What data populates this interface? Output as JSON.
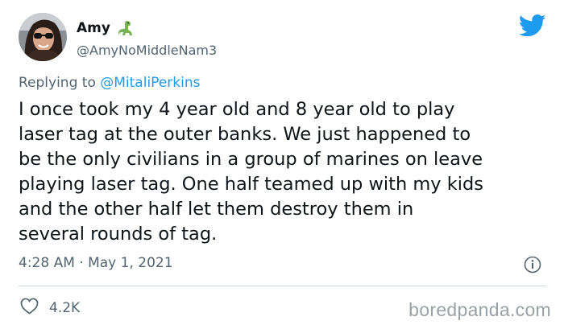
{
  "author": {
    "display_name": "Amy",
    "handle": "@AmyNoMiddleNam3",
    "emoji": "dinosaur-emoji"
  },
  "reply": {
    "prefix": "Replying to",
    "mention": "@MitaliPerkins"
  },
  "tweet": {
    "text": "I once took my 4 year old and 8 year old to play\nlaser tag at the outer banks. We just happened to\nbe the only civilians in a group of marines on leave\nplaying laser tag. One half teamed up with my kids\nand the other half let them destroy them in\nseveral rounds of tag."
  },
  "meta": {
    "timestamp": "4:28 AM · May 1, 2021"
  },
  "actions": {
    "likes": "4.2K"
  },
  "watermark": "boredpanda.com",
  "colors": {
    "twitter_blue": "#1d9bf0",
    "secondary_text": "#536471",
    "primary_text": "#0f1419",
    "divider": "#cfd9de"
  },
  "icons": {
    "logo": "twitter-bird-icon",
    "info": "info-icon",
    "like": "heart-icon"
  }
}
